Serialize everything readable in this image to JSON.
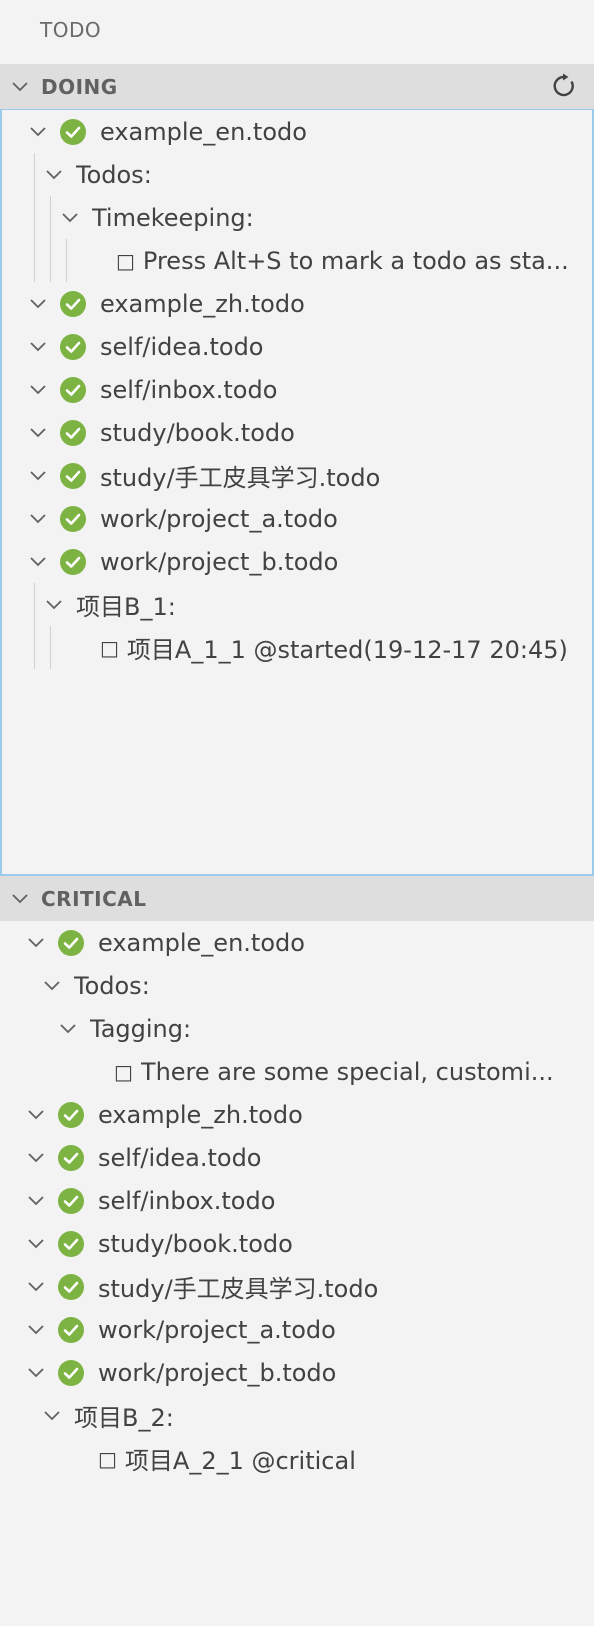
{
  "view_title": "TODO",
  "doing": {
    "header": "DOING",
    "rows": [
      {
        "type": "file",
        "text": "example_en.todo"
      },
      {
        "type": "group",
        "text": "Todos:"
      },
      {
        "type": "group",
        "text": "Timekeeping:"
      },
      {
        "type": "task",
        "text": "Press Alt+S to mark a todo as sta..."
      },
      {
        "type": "file",
        "text": "example_zh.todo"
      },
      {
        "type": "file",
        "text": "self/idea.todo"
      },
      {
        "type": "file",
        "text": "self/inbox.todo"
      },
      {
        "type": "file",
        "text": "study/book.todo"
      },
      {
        "type": "file",
        "text": "study/手工皮具学习.todo"
      },
      {
        "type": "file",
        "text": "work/project_a.todo"
      },
      {
        "type": "file",
        "text": "work/project_b.todo"
      },
      {
        "type": "group",
        "text": "项目B_1:"
      },
      {
        "type": "task",
        "text": "项目A_1_1 @started(19-12-17 20:45)"
      }
    ]
  },
  "critical": {
    "header": "CRITICAL",
    "rows": [
      {
        "type": "file",
        "text": "example_en.todo"
      },
      {
        "type": "group",
        "text": "Todos:"
      },
      {
        "type": "group",
        "text": "Tagging:"
      },
      {
        "type": "task",
        "text": "There are some special, customi..."
      },
      {
        "type": "file",
        "text": "example_zh.todo"
      },
      {
        "type": "file",
        "text": "self/idea.todo"
      },
      {
        "type": "file",
        "text": "self/inbox.todo"
      },
      {
        "type": "file",
        "text": "study/book.todo"
      },
      {
        "type": "file",
        "text": "study/手工皮具学习.todo"
      },
      {
        "type": "file",
        "text": "work/project_a.todo"
      },
      {
        "type": "file",
        "text": "work/project_b.todo"
      },
      {
        "type": "group",
        "text": "项目B_2:"
      },
      {
        "type": "task",
        "text": "项目A_2_1 @critical"
      }
    ]
  },
  "icons": {
    "section_chevron": "chevron-down-icon",
    "refresh": "refresh-icon",
    "file_status": "check-circle-icon",
    "task_checkbox": "checkbox-empty-icon"
  },
  "colors": {
    "background": "#f3f3f3",
    "section_header": "#dedede",
    "focus_border": "#9ccaec",
    "check_green": "#7cb342"
  }
}
